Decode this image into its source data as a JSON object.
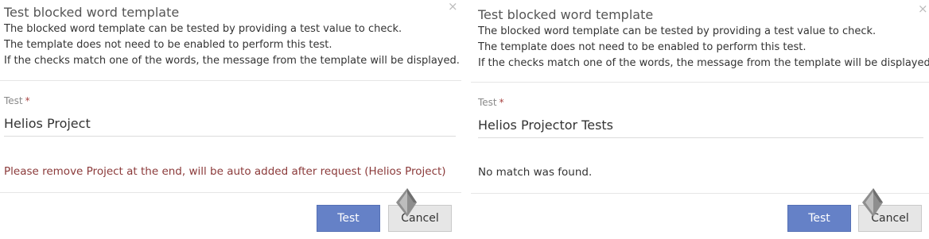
{
  "left_dialog": {
    "title": "Test blocked word template",
    "close_glyph": "×",
    "description": [
      "The blocked word template can be tested by providing a test value to check.",
      "The template does not need to be enabled to perform this test.",
      "If the checks match one of the words, the message from the template will be displayed."
    ],
    "field_label": "Test",
    "required_marker": "*",
    "field_value": "Helios Project",
    "result_message": "Please remove Project at the end, will be auto added after request (Helios Project)",
    "result_color": "#8b3a3a",
    "test_button": "Test",
    "cancel_button": "Cancel"
  },
  "right_dialog": {
    "title": "Test blocked word template",
    "close_glyph": "×",
    "description": [
      "The blocked word template can be tested by providing a test value to check.",
      "The template does not need to be enabled to perform this test.",
      "If the checks match one of the words, the message from the template will be displayed."
    ],
    "field_label": "Test",
    "required_marker": "*",
    "field_value": "Helios Projector Tests",
    "result_message": "No match was found.",
    "test_button": "Test",
    "cancel_button": "Cancel"
  },
  "colors": {
    "primary_button": "#6581c7",
    "secondary_button": "#e6e6e6",
    "required": "#a94442"
  },
  "icons": {
    "close": "close-icon",
    "cursor": "mouse-cursor-icon"
  }
}
